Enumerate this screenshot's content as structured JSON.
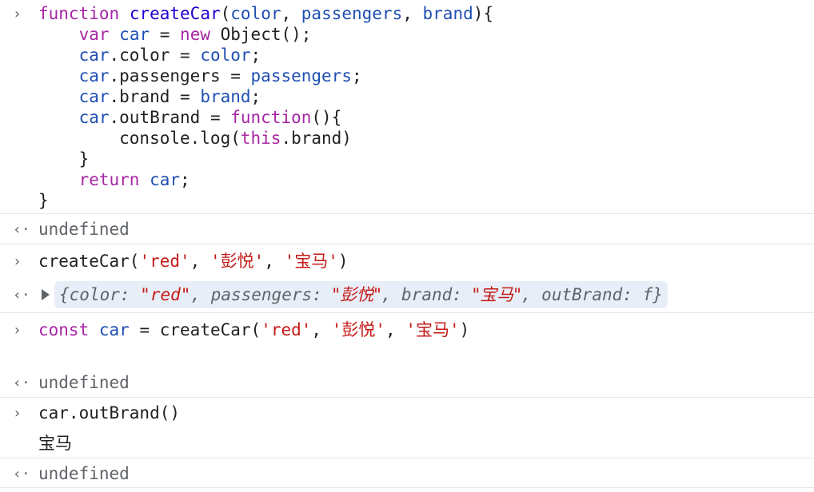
{
  "entries": {
    "function_def": {
      "lines": [
        "function createCar(color, passengers, brand){",
        "    var car = new Object();",
        "    car.color = color;",
        "    car.passengers = passengers;",
        "    car.brand = brand;",
        "    car.outBrand = function(){",
        "        console.log(this.brand)",
        "    }",
        "    return car;",
        "}"
      ]
    },
    "result_1": "undefined",
    "call_1": "createCar('red', '彭悦', '宝马')",
    "object_preview": {
      "open": "{",
      "color_key": "color: ",
      "color_val": "\"red\"",
      "passengers_key": "passengers: ",
      "passengers_val": "\"彭悦\"",
      "brand_key": "brand: ",
      "brand_val": "\"宝马\"",
      "outbrand_key": "outBrand: ",
      "outbrand_val": "f",
      "close": "}",
      "comma": ", "
    },
    "const_line": "const car = createCar('red', '彭悦', '宝马')",
    "result_2": "undefined",
    "call_2": "car.outBrand()",
    "log_output": "宝马",
    "result_3": "undefined"
  },
  "colors": {
    "keyword": "#a626a4",
    "function_name": "#1c00cf",
    "variable": "#1f4fb2",
    "string": "#c41a16",
    "muted": "#5f6368",
    "object_bg": "#e8eef7"
  },
  "icons": {
    "input_prompt": "chevron-right-icon",
    "result_prompt": "return-arrow-icon",
    "expand": "triangle-right-icon"
  }
}
